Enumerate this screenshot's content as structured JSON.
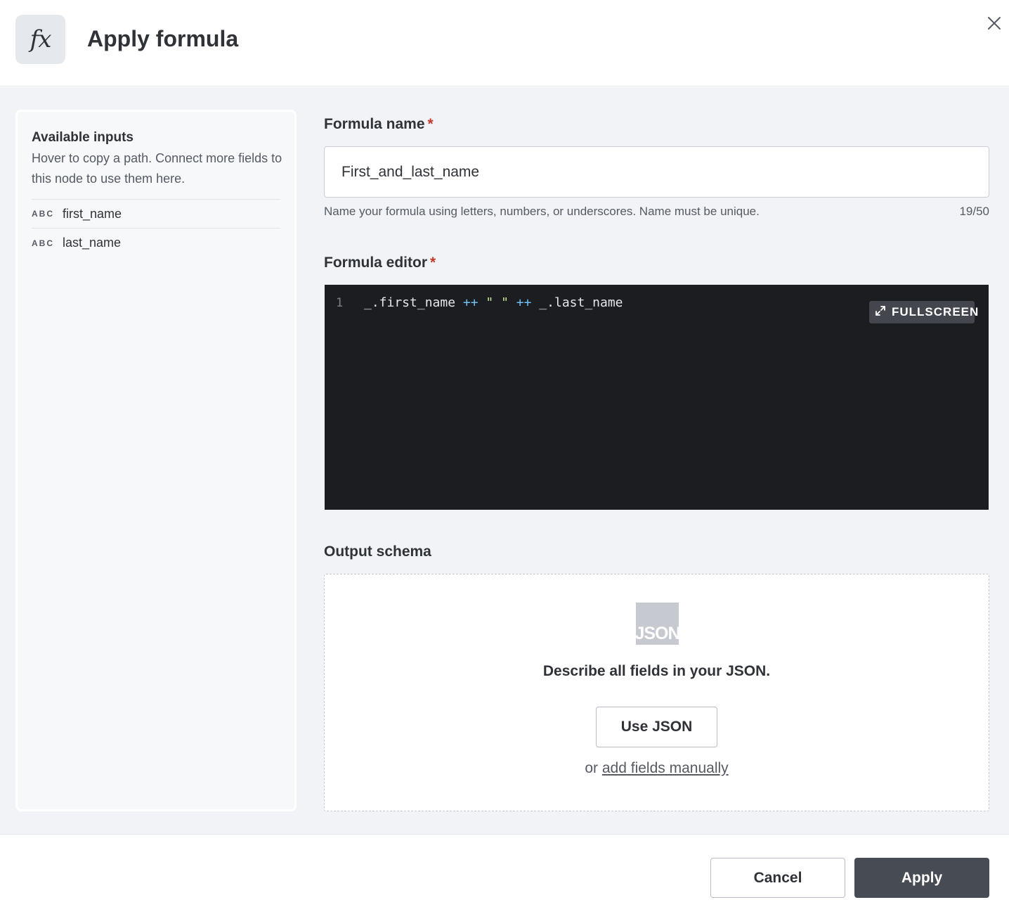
{
  "header": {
    "icon_text": "fx",
    "title": "Apply formula"
  },
  "sidebar": {
    "title": "Available inputs",
    "description": "Hover to copy a path. Connect more fields to this node to use them here.",
    "items": [
      {
        "type": "ABC",
        "name": "first_name"
      },
      {
        "type": "ABC",
        "name": "last_name"
      }
    ]
  },
  "form": {
    "name_label": "Formula name",
    "required_mark": "*",
    "name_value": "First_and_last_name",
    "name_helper": "Name your formula using letters, numbers, or underscores. Name must be unique.",
    "name_counter": "19/50",
    "editor_label": "Formula editor",
    "editor": {
      "line_number": "1",
      "code_tokens": {
        "t1": "_.first_name ",
        "t2": "++",
        "t3": " ",
        "t4": "\" \"",
        "t5": " ",
        "t6": "++",
        "t7": " _.last_name"
      },
      "fullscreen_label": "FULLSCREEN"
    },
    "schema_label": "Output schema",
    "schema": {
      "icon_text": "JSON",
      "describe_text": "Describe all fields in your JSON.",
      "use_json_label": "Use JSON",
      "or_text": "or",
      "manual_link": "add fields manually"
    }
  },
  "footer": {
    "cancel_label": "Cancel",
    "apply_label": "Apply"
  },
  "colors": {
    "primary_button": "#474b53",
    "required": "#c23a2b",
    "editor_bg": "#1c1d21",
    "operator": "#6ec1f2",
    "string": "#c9e59a"
  }
}
